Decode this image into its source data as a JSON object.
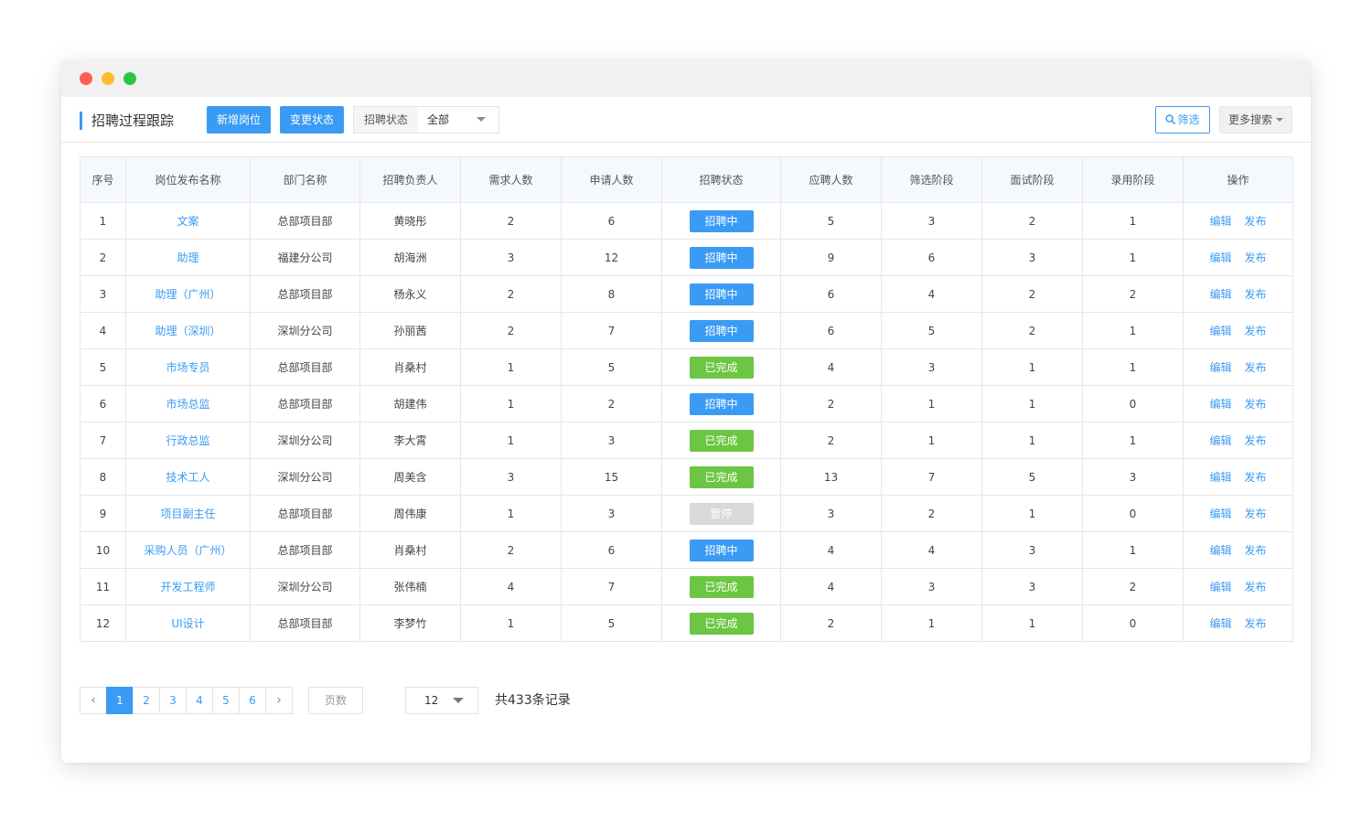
{
  "page": {
    "title": "招聘过程跟踪"
  },
  "toolbar": {
    "add_label": "新增岗位",
    "change_label": "变更状态",
    "filter_label": "招聘状态",
    "filter_value": "全部",
    "screen_label": "筛选",
    "more_label": "更多搜索"
  },
  "colors": {
    "accent": "#3a9bf4",
    "recruiting": "#3a9bf4",
    "done": "#6cc644",
    "paused": "#d9d9d9"
  },
  "table": {
    "headers": [
      "序号",
      "岗位发布名称",
      "部门名称",
      "招聘负责人",
      "需求人数",
      "申请人数",
      "招聘状态",
      "应聘人数",
      "筛选阶段",
      "面试阶段",
      "录用阶段",
      "操作"
    ],
    "rows": [
      {
        "no": "1",
        "name": "文案",
        "dept": "总部项目部",
        "owner": "黄晓彤",
        "need": "2",
        "apply": "6",
        "status": "招聘中",
        "status_type": "recruiting",
        "candidates": "5",
        "screen": "3",
        "interview": "2",
        "hire": "1"
      },
      {
        "no": "2",
        "name": "助理",
        "dept": "福建分公司",
        "owner": "胡海洲",
        "need": "3",
        "apply": "12",
        "status": "招聘中",
        "status_type": "recruiting",
        "candidates": "9",
        "screen": "6",
        "interview": "3",
        "hire": "1"
      },
      {
        "no": "3",
        "name": "助理（广州）",
        "dept": "总部项目部",
        "owner": "杨永义",
        "need": "2",
        "apply": "8",
        "status": "招聘中",
        "status_type": "recruiting",
        "candidates": "6",
        "screen": "4",
        "interview": "2",
        "hire": "2"
      },
      {
        "no": "4",
        "name": "助理（深圳）",
        "dept": "深圳分公司",
        "owner": "孙丽茜",
        "need": "2",
        "apply": "7",
        "status": "招聘中",
        "status_type": "recruiting",
        "candidates": "6",
        "screen": "5",
        "interview": "2",
        "hire": "1"
      },
      {
        "no": "5",
        "name": "市场专员",
        "dept": "总部项目部",
        "owner": "肖桑村",
        "need": "1",
        "apply": "5",
        "status": "已完成",
        "status_type": "done",
        "candidates": "4",
        "screen": "3",
        "interview": "1",
        "hire": "1"
      },
      {
        "no": "6",
        "name": "市场总监",
        "dept": "总部项目部",
        "owner": "胡建伟",
        "need": "1",
        "apply": "2",
        "status": "招聘中",
        "status_type": "recruiting",
        "candidates": "2",
        "screen": "1",
        "interview": "1",
        "hire": "0"
      },
      {
        "no": "7",
        "name": "行政总监",
        "dept": "深圳分公司",
        "owner": "李大霄",
        "need": "1",
        "apply": "3",
        "status": "已完成",
        "status_type": "done",
        "candidates": "2",
        "screen": "1",
        "interview": "1",
        "hire": "1"
      },
      {
        "no": "8",
        "name": "技术工人",
        "dept": "深圳分公司",
        "owner": "周美含",
        "need": "3",
        "apply": "15",
        "status": "已完成",
        "status_type": "done",
        "candidates": "13",
        "screen": "7",
        "interview": "5",
        "hire": "3"
      },
      {
        "no": "9",
        "name": "项目副主任",
        "dept": "总部项目部",
        "owner": "周伟康",
        "need": "1",
        "apply": "3",
        "status": "暂停",
        "status_type": "paused",
        "candidates": "3",
        "screen": "2",
        "interview": "1",
        "hire": "0"
      },
      {
        "no": "10",
        "name": "采购人员（广州）",
        "dept": "总部项目部",
        "owner": "肖桑村",
        "need": "2",
        "apply": "6",
        "status": "招聘中",
        "status_type": "recruiting",
        "candidates": "4",
        "screen": "4",
        "interview": "3",
        "hire": "1"
      },
      {
        "no": "11",
        "name": "开发工程师",
        "dept": "深圳分公司",
        "owner": "张伟楠",
        "need": "4",
        "apply": "7",
        "status": "已完成",
        "status_type": "done",
        "candidates": "4",
        "screen": "3",
        "interview": "3",
        "hire": "2"
      },
      {
        "no": "12",
        "name": "UI设计",
        "dept": "总部项目部",
        "owner": "李梦竹",
        "need": "1",
        "apply": "5",
        "status": "已完成",
        "status_type": "done",
        "candidates": "2",
        "screen": "1",
        "interview": "1",
        "hire": "0"
      }
    ],
    "edit_label": "编辑",
    "publish_label": "发布"
  },
  "pagination": {
    "pages": [
      "1",
      "2",
      "3",
      "4",
      "5",
      "6"
    ],
    "current": "1",
    "page_input_placeholder": "页数",
    "page_size": "12",
    "total_text": "共433条记录"
  }
}
